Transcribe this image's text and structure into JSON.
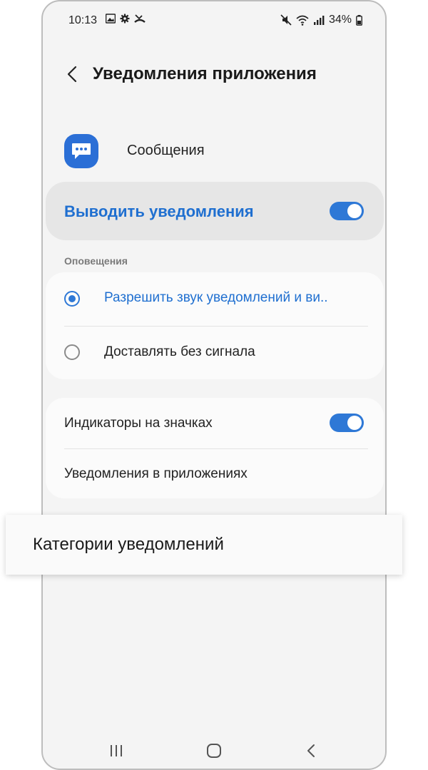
{
  "status_bar": {
    "time": "10:13",
    "battery": "34%",
    "left_icons": [
      "image-icon",
      "gear-icon",
      "missed-call-icon"
    ],
    "right_icons": [
      "mute-icon",
      "wifi-icon",
      "signal-icon",
      "battery-icon"
    ]
  },
  "header": {
    "title": "Уведомления приложения"
  },
  "app": {
    "name": "Сообщения",
    "icon": "messages-app-icon",
    "accent": "#2b6fd6"
  },
  "main_toggle": {
    "label": "Выводить уведомления",
    "on": true
  },
  "alerts_section": {
    "label": "Оповещения",
    "options": [
      {
        "label": "Разрешить звук уведомлений и ви..",
        "selected": true
      },
      {
        "label": "Доставлять без сигнала",
        "selected": false
      }
    ]
  },
  "more_settings": {
    "badges_label": "Индикаторы на значках",
    "badges_on": true,
    "in_app_label": "Уведомления в приложениях"
  },
  "highlight": {
    "label": "Категории уведомлений"
  },
  "colors": {
    "accent_blue": "#2e78d6",
    "text_blue": "#1f6fd0"
  }
}
